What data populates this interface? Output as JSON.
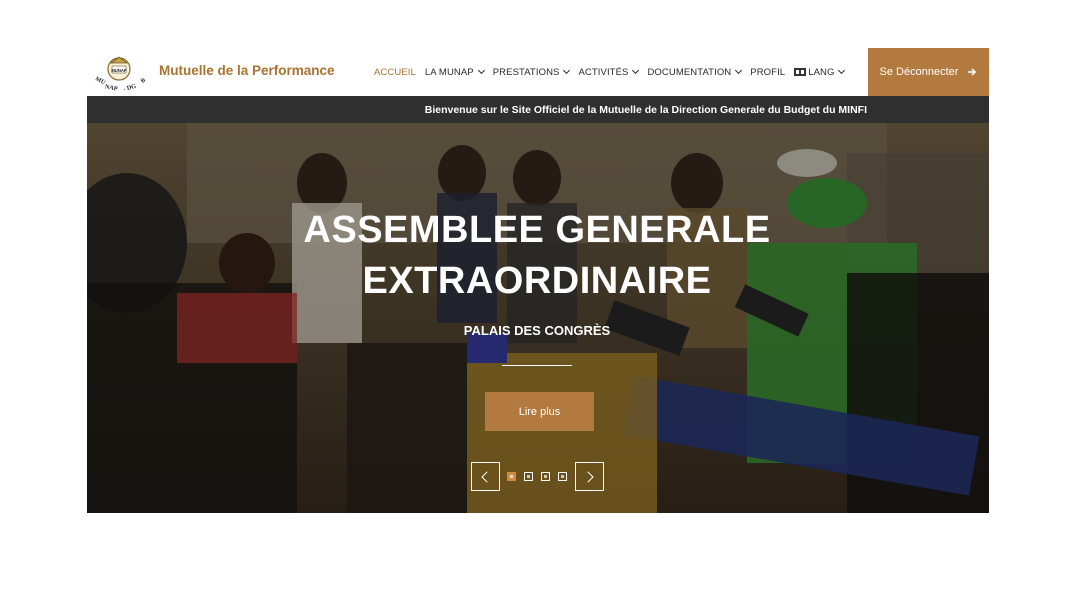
{
  "header": {
    "brand": "Mutuelle de la Performance",
    "logo_text_top": "MUNAP - DGB",
    "logo_badge": "MUNAP"
  },
  "nav": {
    "items": [
      {
        "label": "ACCUEIL",
        "active": true,
        "dropdown": false
      },
      {
        "label": "LA MUNAP",
        "active": false,
        "dropdown": true
      },
      {
        "label": "PRESTATIONS",
        "active": false,
        "dropdown": true
      },
      {
        "label": "ACTIVITÉS",
        "active": false,
        "dropdown": true
      },
      {
        "label": "DOCUMENTATION",
        "active": false,
        "dropdown": true
      },
      {
        "label": "PROFIL",
        "active": false,
        "dropdown": false
      },
      {
        "label": "LANG",
        "active": false,
        "dropdown": true,
        "icon": "flag-icon"
      }
    ],
    "logout_label": "Se Déconnecter"
  },
  "welcome_text": "Bienvenue sur le Site Officiel de la Mutuelle de la Direction Generale du Budget du MINFI",
  "hero": {
    "title_line1": "ASSEMBLEE GENERALE",
    "title_line2": "EXTRAORDINAIRE",
    "subtitle": "PALAIS DES CONGRÈS",
    "button_label": "Lire plus",
    "slide_count": 4,
    "active_slide": 1
  },
  "colors": {
    "accent": "#b27a3e",
    "brand_text": "#a9722f",
    "welcome_bg": "#2f2f2f"
  }
}
